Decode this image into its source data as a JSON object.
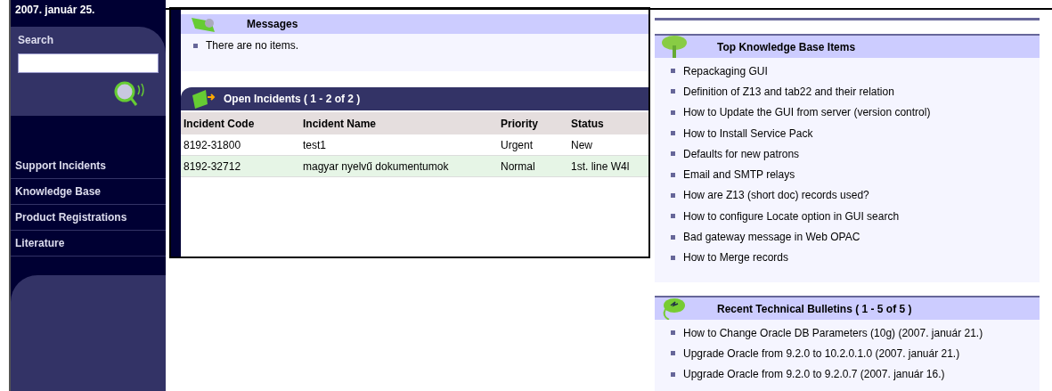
{
  "sidebar": {
    "date": "2007. január 25.",
    "search": {
      "tab": "Search"
    },
    "nav": [
      {
        "label": "Support Incidents"
      },
      {
        "label": "Knowledge Base"
      },
      {
        "label": "Product Registrations"
      },
      {
        "label": "Literature"
      }
    ]
  },
  "messages": {
    "title": "Messages",
    "items": [
      "There are no items."
    ]
  },
  "incidents": {
    "title": "Open Incidents ( 1 - 2 of 2 )",
    "columns": [
      "Incident Code",
      "Incident Name",
      "Priority",
      "Status"
    ],
    "rows": [
      {
        "cells": [
          "8192-31800",
          "test1",
          "Urgent",
          "New"
        ],
        "selected": false
      },
      {
        "cells": [
          "8192-32712",
          "magyar nyelvű dokumentumok",
          "Normal",
          "1st. line W4l"
        ],
        "selected": true
      }
    ]
  },
  "knowledge_base": {
    "title": "Top Knowledge Base Items",
    "items": [
      "Repackaging GUI",
      "Definition of Z13 and tab22 and their relation",
      "How to Update the GUI from server (version control)",
      "How to Install Service Pack",
      "Defaults for new patrons",
      "Email and SMTP relays",
      "How are Z13 (short doc) records used?",
      "How to configure Locate option in GUI search",
      "Bad gateway message in Web OPAC",
      "How to Merge records"
    ]
  },
  "bulletins": {
    "title": "Recent Technical Bulletins ( 1 - 5 of 5 )",
    "items": [
      "How to Change Oracle DB Parameters (10g) (2007. január 21.)",
      "Upgrade Oracle from 9.2.0 to 10.2.0.1.0 (2007. január 21.)",
      "Upgrade Oracle from 9.2.0 to 9.2.0.7 (2007. január 16.)"
    ]
  }
}
